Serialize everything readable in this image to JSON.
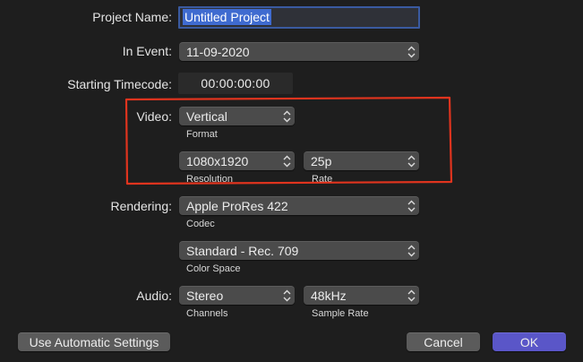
{
  "form": {
    "project_name_label": "Project Name:",
    "project_name_value": "Untitled Project",
    "in_event_label": "In Event:",
    "in_event_value": "11-09-2020",
    "starting_timecode_label": "Starting Timecode:",
    "starting_timecode_value": "00:00:00:00",
    "video_label": "Video:",
    "format_value": "Vertical",
    "format_caption": "Format",
    "resolution_value": "1080x1920",
    "resolution_caption": "Resolution",
    "rate_value": "25p",
    "rate_caption": "Rate",
    "rendering_label": "Rendering:",
    "codec_value": "Apple ProRes 422",
    "codec_caption": "Codec",
    "color_space_value": "Standard - Rec. 709",
    "color_space_caption": "Color Space",
    "audio_label": "Audio:",
    "channels_value": "Stereo",
    "channels_caption": "Channels",
    "sample_rate_value": "48kHz",
    "sample_rate_caption": "Sample Rate"
  },
  "buttons": {
    "automatic_label": "Use Automatic Settings",
    "cancel_label": "Cancel",
    "ok_label": "OK"
  },
  "colors": {
    "background": "#1e1e1e",
    "highlight_annotation": "#e0341e",
    "primary_button": "#5a56c8",
    "text_selection": "#3f6bd0"
  },
  "icons": {
    "popup_indicator": "up-down-chevron-icon"
  }
}
